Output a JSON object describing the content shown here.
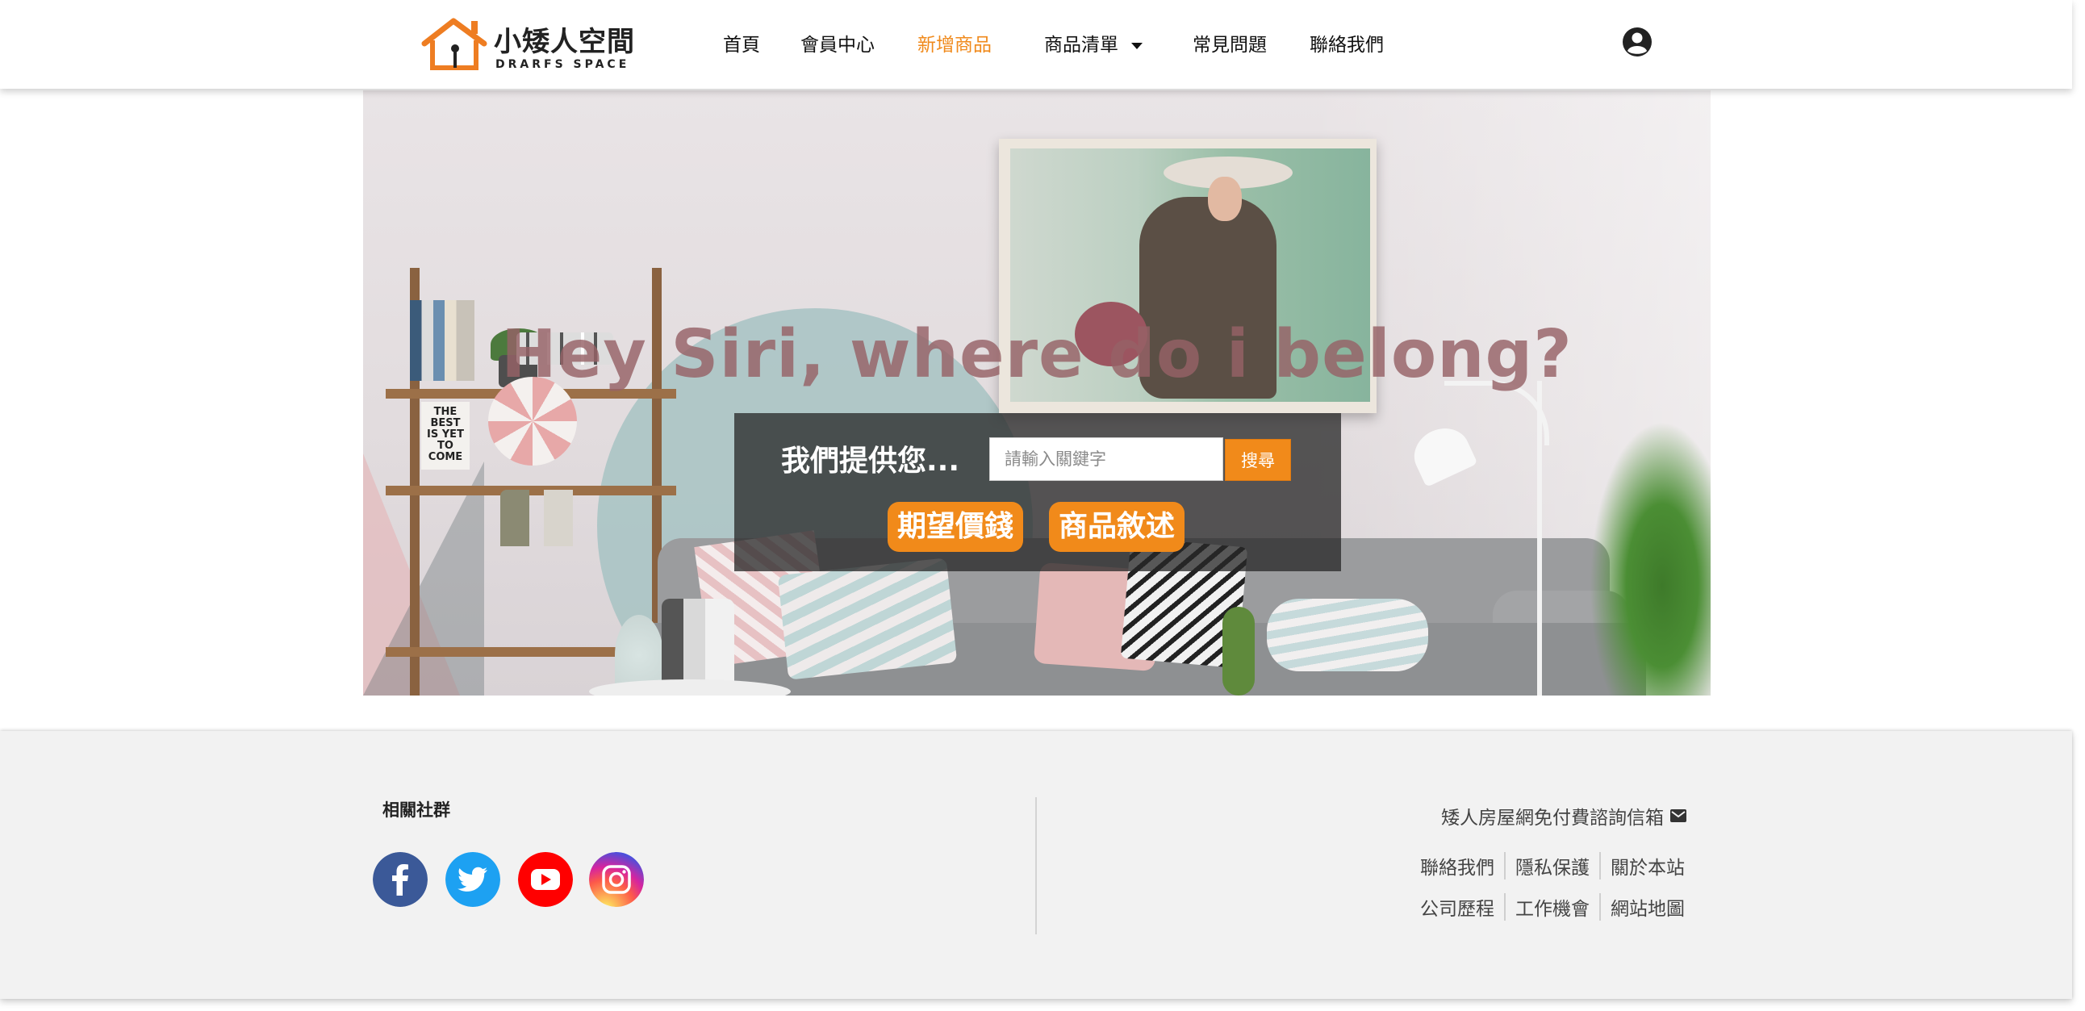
{
  "header": {
    "logo": {
      "name_cn": "小矮人空間",
      "name_en": "DRARFS SPACE"
    },
    "nav": [
      {
        "label": "首頁",
        "active": false
      },
      {
        "label": "會員中心",
        "active": false
      },
      {
        "label": "新增商品",
        "active": true
      },
      {
        "label": "商品清單",
        "active": false,
        "dropdown": true
      },
      {
        "label": "常見問題",
        "active": false
      },
      {
        "label": "聯絡我們",
        "active": false
      }
    ],
    "user_icon": "user-circle-icon"
  },
  "hero": {
    "title": "Hey Siri, where do i belong?",
    "search": {
      "label": "我們提供您...",
      "placeholder": "請輸入關鍵字",
      "button": "搜尋"
    },
    "pills": [
      "期望價錢",
      "商品敘述"
    ],
    "sign_text": "THE BEST IS YET TO COME"
  },
  "footer": {
    "social_title": "相關社群",
    "social": [
      {
        "name": "facebook-icon",
        "color": "#3b5998"
      },
      {
        "name": "twitter-icon",
        "color": "#1da1f2"
      },
      {
        "name": "youtube-icon",
        "color": "#ff0000"
      },
      {
        "name": "instagram-icon",
        "color": "#c13584"
      }
    ],
    "contact": "矮人房屋網免付費諮詢信箱",
    "links_row1": [
      "聯絡我們",
      "隱私保護",
      "關於本站"
    ],
    "links_row2": [
      "公司歷程",
      "工作機會",
      "網站地圖"
    ]
  },
  "colors": {
    "accent": "#f18a1a",
    "hero_title": "#966266"
  }
}
